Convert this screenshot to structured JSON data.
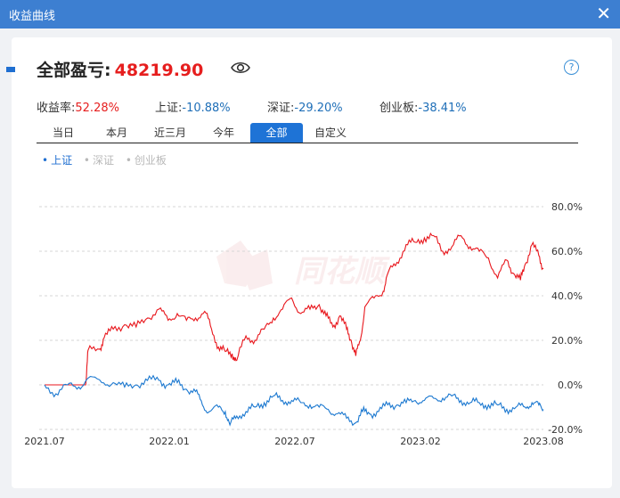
{
  "window": {
    "title": "收益曲线",
    "close_glyph": "✕"
  },
  "summary": {
    "label": "全部盈亏:",
    "amount": "48219.90"
  },
  "help_glyph": "?",
  "stats": [
    {
      "label": "收益率:",
      "value": "52.28%"
    },
    {
      "label": "上证:",
      "value": "-10.88%"
    },
    {
      "label": "深证:",
      "value": "-29.20%"
    },
    {
      "label": "创业板:",
      "value": "-38.41%"
    }
  ],
  "tabs": [
    {
      "label": "当日"
    },
    {
      "label": "本月"
    },
    {
      "label": "近三月"
    },
    {
      "label": "今年"
    },
    {
      "label": "全部",
      "active": true
    },
    {
      "label": "自定义"
    }
  ],
  "legend": [
    {
      "label": "上证",
      "active": true
    },
    {
      "label": "深证",
      "active": false
    },
    {
      "label": "创业板",
      "active": false
    }
  ],
  "watermark": "同花顺",
  "colors": {
    "portfolio": "#e8161c",
    "shanghai": "#1b78d0",
    "accent": "#1e73d6"
  },
  "chart_data": {
    "type": "line",
    "x_ticks": [
      "2021.07",
      "2022.01",
      "2022.07",
      "2023.02",
      "2023.08"
    ],
    "y_ticks": [
      "80.0%",
      "60.0%",
      "40.0%",
      "20.0%",
      "0.0%",
      "-20.0%"
    ],
    "ylim": [
      -20,
      80
    ],
    "grid": true,
    "series": [
      {
        "name": "收益率",
        "color": "#e8161c",
        "points": [
          [
            2021.5,
            0
          ],
          [
            2021.6,
            0
          ],
          [
            2021.68,
            0
          ],
          [
            2021.69,
            15.5
          ],
          [
            2021.74,
            16
          ],
          [
            2021.76,
            21
          ],
          [
            2021.8,
            25
          ],
          [
            2021.85,
            27
          ],
          [
            2021.9,
            26
          ],
          [
            2021.95,
            30
          ],
          [
            2022.0,
            34
          ],
          [
            2022.04,
            29
          ],
          [
            2022.08,
            32
          ],
          [
            2022.12,
            29
          ],
          [
            2022.16,
            30
          ],
          [
            2022.2,
            33
          ],
          [
            2022.23,
            25
          ],
          [
            2022.26,
            17
          ],
          [
            2022.29,
            15
          ],
          [
            2022.32,
            14
          ],
          [
            2022.34,
            11
          ],
          [
            2022.38,
            22
          ],
          [
            2022.42,
            20
          ],
          [
            2022.46,
            25
          ],
          [
            2022.5,
            30
          ],
          [
            2022.54,
            34
          ],
          [
            2022.58,
            39
          ],
          [
            2022.62,
            32
          ],
          [
            2022.66,
            34
          ],
          [
            2022.7,
            36
          ],
          [
            2022.73,
            31
          ],
          [
            2022.76,
            26
          ],
          [
            2022.79,
            31
          ],
          [
            2022.82,
            25
          ],
          [
            2022.84,
            20
          ],
          [
            2022.86,
            13
          ],
          [
            2022.88,
            20
          ],
          [
            2022.9,
            35
          ],
          [
            2022.94,
            39
          ],
          [
            2022.98,
            42
          ],
          [
            2023.0,
            50
          ],
          [
            2023.04,
            55
          ],
          [
            2023.08,
            63
          ],
          [
            2023.12,
            64
          ],
          [
            2023.16,
            66
          ],
          [
            2023.2,
            67
          ],
          [
            2023.24,
            60
          ],
          [
            2023.28,
            62
          ],
          [
            2023.32,
            67
          ],
          [
            2023.36,
            62
          ],
          [
            2023.4,
            60
          ],
          [
            2023.44,
            57
          ],
          [
            2023.48,
            48
          ],
          [
            2023.52,
            56
          ],
          [
            2023.55,
            50
          ],
          [
            2023.58,
            47
          ],
          [
            2023.6,
            54
          ],
          [
            2023.63,
            63
          ],
          [
            2023.66,
            58
          ],
          [
            2023.68,
            52
          ]
        ]
      },
      {
        "name": "上证",
        "color": "#1b78d0",
        "points": [
          [
            2021.5,
            0
          ],
          [
            2021.55,
            -4
          ],
          [
            2021.6,
            0
          ],
          [
            2021.65,
            -1
          ],
          [
            2021.69,
            3
          ],
          [
            2021.75,
            1
          ],
          [
            2021.8,
            1
          ],
          [
            2021.85,
            -1
          ],
          [
            2021.9,
            0
          ],
          [
            2021.95,
            2
          ],
          [
            2022.0,
            2
          ],
          [
            2022.04,
            0
          ],
          [
            2022.08,
            1
          ],
          [
            2022.12,
            -2
          ],
          [
            2022.16,
            -3
          ],
          [
            2022.19,
            -9
          ],
          [
            2022.22,
            -12
          ],
          [
            2022.26,
            -10
          ],
          [
            2022.29,
            -12
          ],
          [
            2022.31,
            -18
          ],
          [
            2022.34,
            -14
          ],
          [
            2022.38,
            -12
          ],
          [
            2022.42,
            -10
          ],
          [
            2022.46,
            -8
          ],
          [
            2022.5,
            -5
          ],
          [
            2022.54,
            -7
          ],
          [
            2022.58,
            -7
          ],
          [
            2022.62,
            -8
          ],
          [
            2022.66,
            -9
          ],
          [
            2022.7,
            -10
          ],
          [
            2022.74,
            -11
          ],
          [
            2022.78,
            -13
          ],
          [
            2022.82,
            -15
          ],
          [
            2022.86,
            -17
          ],
          [
            2022.89,
            -12
          ],
          [
            2022.92,
            -13
          ],
          [
            2022.96,
            -12
          ],
          [
            2023.0,
            -9
          ],
          [
            2023.04,
            -9
          ],
          [
            2023.08,
            -8
          ],
          [
            2023.12,
            -7
          ],
          [
            2023.16,
            -7
          ],
          [
            2023.2,
            -6
          ],
          [
            2023.24,
            -6
          ],
          [
            2023.28,
            -5
          ],
          [
            2023.32,
            -7
          ],
          [
            2023.36,
            -8
          ],
          [
            2023.4,
            -8
          ],
          [
            2023.44,
            -9
          ],
          [
            2023.48,
            -9
          ],
          [
            2023.52,
            -11
          ],
          [
            2023.56,
            -10
          ],
          [
            2023.6,
            -10
          ],
          [
            2023.63,
            -8
          ],
          [
            2023.66,
            -9
          ],
          [
            2023.68,
            -11
          ]
        ]
      }
    ]
  }
}
